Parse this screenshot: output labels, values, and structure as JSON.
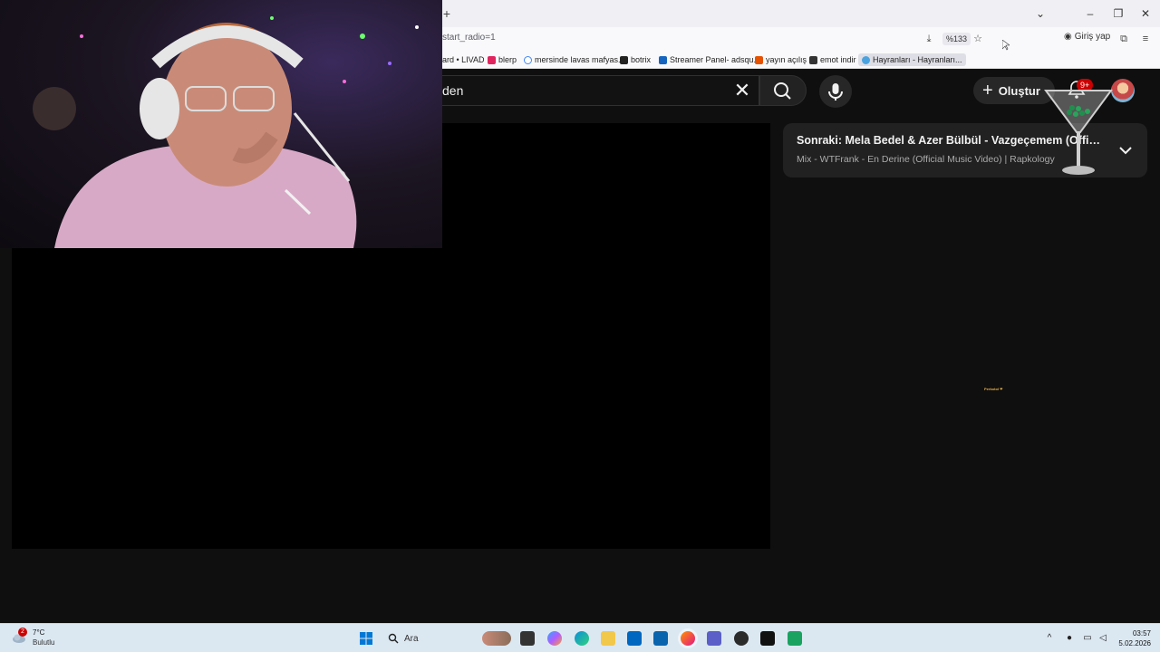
{
  "browser": {
    "url_fragment": "start_radio=1",
    "zoom": "%133",
    "signin_label": "Giriş yap",
    "new_tab": "+",
    "bookmarks": [
      {
        "label": "ard • LIVAD",
        "color": "#666666"
      },
      {
        "label": "blerp",
        "color": "#e0245e"
      },
      {
        "label": "mersinde lavas mafyas...",
        "color": "#4285f4"
      },
      {
        "label": "botrix",
        "color": "#222222"
      },
      {
        "label": "Streamer Panel- adsqu...",
        "color": "#1565c0"
      },
      {
        "label": "yayın açılış",
        "color": "#e65100"
      },
      {
        "label": "emot indir",
        "color": "#333333"
      },
      {
        "label": "Hayranları - Hayranları...",
        "color": "#4aa3df"
      }
    ]
  },
  "youtube": {
    "search_text": "den",
    "create_label": "Oluştur",
    "notification_count": "9+",
    "up_next": {
      "title": "Sonraki: Mela Bedel & Azer Bülbül - Vazgeçemem (Official L...",
      "subtitle": "Mix - WTFrank - En Derine (Official Music Video) | Rapkology"
    },
    "tiny_overlay_text": "Perkotol ❤"
  },
  "taskbar": {
    "weather_alert": "2",
    "temperature": "7°C",
    "weather_desc": "Bulutlu",
    "search_placeholder": "Ara",
    "time": "03:57",
    "date": "5.02.2026"
  },
  "colors": {
    "yt_background": "#0f0f0f",
    "taskbar": "#dbe8f2",
    "accent_red": "#cc0000"
  }
}
